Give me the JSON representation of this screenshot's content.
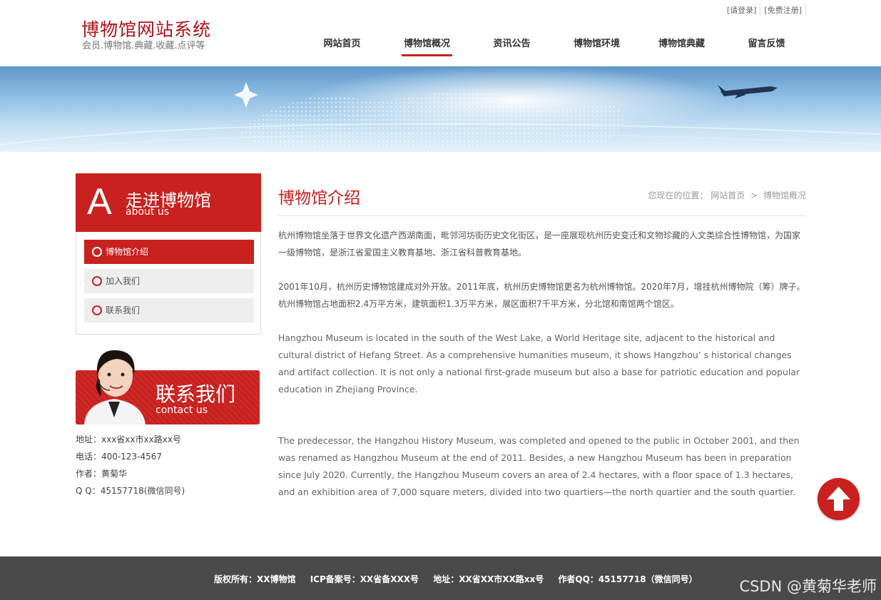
{
  "header": {
    "site_title": "博物馆网站系统",
    "site_subtitle": "会员.博物馆.典藏.收藏.点评等",
    "top_links": {
      "login": "[请登录]",
      "register": "[免费注册]"
    },
    "nav": [
      {
        "label": "网站首页",
        "active": false
      },
      {
        "label": "博物馆概况",
        "active": true
      },
      {
        "label": "资讯公告",
        "active": false
      },
      {
        "label": "博物馆环境",
        "active": false
      },
      {
        "label": "博物馆典藏",
        "active": false
      },
      {
        "label": "留言反馈",
        "active": false
      }
    ]
  },
  "sidebar": {
    "head_letter": "A",
    "head_cn": "走进博物馆",
    "head_en": "about us",
    "items": [
      {
        "label": "博物馆介绍",
        "active": true
      },
      {
        "label": "加入我们",
        "active": false
      },
      {
        "label": "联系我们",
        "active": false
      }
    ],
    "contact": {
      "cn": "联系我们",
      "en": "contact us",
      "address": "地址：xxx省xx市xx路xx号",
      "phone": "电话：400-123-4567",
      "author": "作者：黄菊华",
      "qq": "Q Q：45157718(微信同号)"
    }
  },
  "main": {
    "title": "博物馆介绍",
    "breadcrumb": {
      "prefix": "您现在的位置：",
      "home": "网站首页",
      "sep": ">",
      "current": "博物馆概况"
    },
    "paragraphs": [
      "杭州博物馆坐落于世界文化遗产西湖南面，毗邻河坊街历史文化街区，是一座展现杭州历史变迁和文物珍藏的人文类综合性博物馆，为国家一级博物馆，是浙江省爱国主义教育基地、浙江省科普教育基地。",
      "2001年10月，杭州历史博物馆建成对外开放。2011年底，杭州历史博物馆更名为杭州博物馆。2020年7月，增挂杭州博物院（筹）牌子。杭州博物馆占地面积2.4万平方米，建筑面积1.3万平方米，展区面积7千平方米，分北馆和南馆两个馆区。",
      "Hangzhou Museum is located in the south of the West Lake, a World Heritage site, adjacent to the historical and cultural district of Hefang Street. As a comprehensive humanities museum, it shows Hangzhou’ s historical changes and artifact collection. It is not only a national first-grade museum but also a base for patriotic education and popular education in Zhejiang Province.",
      "The predecessor, the Hangzhou History Museum, was completed and opened to the public in October 2001, and then was renamed as Hangzhou Museum at the end of 2011. Besides, a new Hangzhou Museum has been in preparation since July 2020. Currently, the Hangzhou Museum covers an area of 2.4 hectares, with a floor space of 1.3 hectares, and an exhibition area of 7,000 square meters, divided into two quartiers—the north quartier and the south quartier."
    ]
  },
  "footer": {
    "copyright": "版权所有：XX博物馆",
    "icp": "ICP备案号：XX省备XXX号",
    "address": "地址：XX省XX市XX路xx号",
    "qq": "作者QQ：45157718（微信同号）",
    "watermark": "CSDN @黄菊华老师"
  },
  "colors": {
    "accent": "#c9211f",
    "footer_bg": "#4a4a4a"
  },
  "icons": {
    "back_to_top": "arrow-up-icon",
    "menu_bullet": "ring-icon"
  }
}
